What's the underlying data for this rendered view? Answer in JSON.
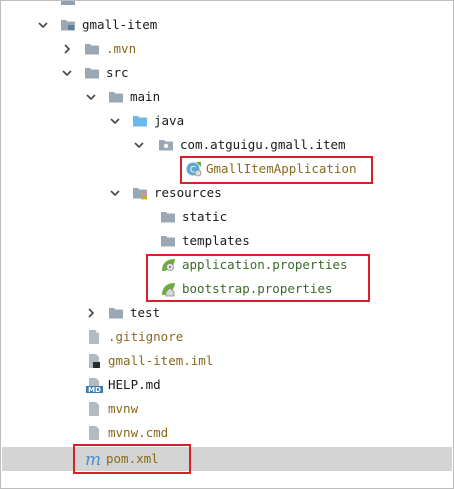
{
  "tree": {
    "root": {
      "label": "gmall-item"
    },
    "mvn": {
      "label": ".mvn"
    },
    "src": {
      "label": "src"
    },
    "main": {
      "label": "main"
    },
    "java": {
      "label": "java"
    },
    "pkg": {
      "label": "com.atguigu.gmall.item"
    },
    "app_class": {
      "label": "GmallItemApplication"
    },
    "resources": {
      "label": "resources"
    },
    "static": {
      "label": "static"
    },
    "templates": {
      "label": "templates"
    },
    "app_props": {
      "label": "application.properties"
    },
    "boot_props": {
      "label": "bootstrap.properties"
    },
    "test": {
      "label": "test"
    },
    "gitignore": {
      "label": ".gitignore"
    },
    "iml": {
      "label": "gmall-item.iml"
    },
    "help": {
      "label": "HELP.md"
    },
    "mvnw": {
      "label": "mvnw"
    },
    "mvnw_cmd": {
      "label": "mvnw.cmd"
    },
    "pom": {
      "label": "pom.xml"
    }
  },
  "icons": {
    "md_badge": "MD",
    "maven_badge": "m"
  },
  "colors": {
    "highlight_box": "#d8202a",
    "selected_row": "#d4d4d4",
    "folder": "#9aa7b4",
    "source_folder": "#6cb8e6",
    "spring_green": "#6cad3b"
  }
}
